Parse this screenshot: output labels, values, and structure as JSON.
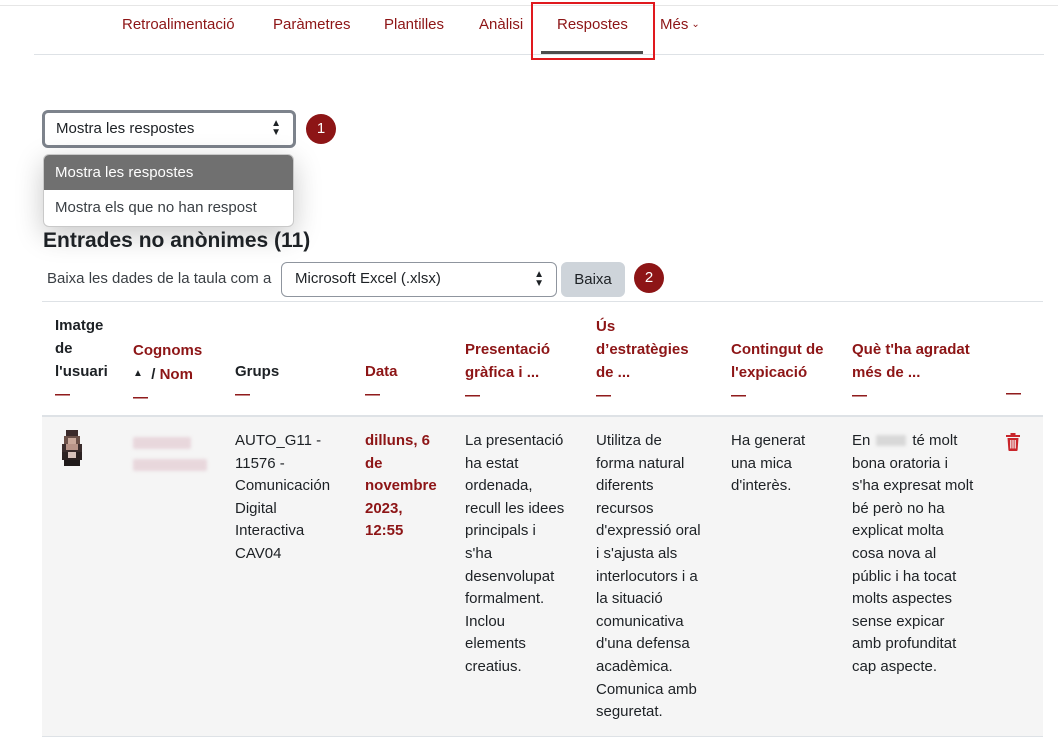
{
  "nav": {
    "tabs": [
      {
        "label": "Retroalimentació"
      },
      {
        "label": "Paràmetres"
      },
      {
        "label": "Plantilles"
      },
      {
        "label": "Anàlisi"
      },
      {
        "label": "Respostes"
      },
      {
        "label": "Més"
      }
    ]
  },
  "response_filter": {
    "selected": "Mostra les respostes",
    "options": [
      "Mostra les respostes",
      "Mostra els que no han respost"
    ]
  },
  "badges": {
    "first": "1",
    "second": "2"
  },
  "section": {
    "title": "Entrades no anònimes (11)"
  },
  "download": {
    "label": "Baixa les dades de la taula com a",
    "format": "Microsoft Excel (.xlsx)",
    "button": "Baixa"
  },
  "table": {
    "headers": {
      "image_line1": "Imatge",
      "image_line2": "de",
      "image_line3": "l'usuari",
      "surname": "Cognoms",
      "name": "Nom",
      "groups": "Grups",
      "date": "Data",
      "q1_line1": "Presentació",
      "q1_line2": "gràfica i ...",
      "q2_line1": "Ús",
      "q2_line2": "d’estratègies",
      "q2_line3": "de ...",
      "q3_line1": "Contingut de",
      "q3_line2": "l'expicació",
      "q4_line1": "Què t'ha agradat",
      "q4_line2": "més de ...",
      "collapse": "—"
    },
    "rows": [
      {
        "group": [
          "AUTO_G11 -",
          "11576 -",
          "Comunicación",
          "Digital",
          "Interactiva",
          "CAV04"
        ],
        "date": [
          "dilluns, 6",
          "de",
          "novembre",
          "2023,",
          "12:55"
        ],
        "q1": [
          "La presentació",
          "ha estat",
          "ordenada,",
          "recull les idees",
          "principals i",
          "s'ha",
          "desenvolupat",
          "formalment.",
          "Inclou",
          "elements",
          "creatius."
        ],
        "q2": [
          "Utilitza de",
          "forma natural",
          "diferents",
          "recursos",
          "d'expressió oral",
          "i s'ajusta als",
          "interlocutors i a",
          "la situació",
          "comunicativa",
          "d'una defensa",
          "acadèmica.",
          "Comunica amb",
          "seguretat."
        ],
        "q3": [
          "Ha generat",
          "una mica",
          "d'interès."
        ],
        "q4_first_prefix": "En",
        "q4_first_suffix": "té molt",
        "q4": [
          "bona oratoria i",
          "s'ha expresat molt",
          "bé però no ha",
          "explicat molta",
          "cosa nova al",
          "públic i ha tocat",
          "molts aspectes",
          "sense expicar",
          "amb profunditat",
          "cap aspecte."
        ]
      }
    ]
  },
  "colors": {
    "accent": "#8d1516",
    "highlight": "#e0191e",
    "button_bg": "#ced4da",
    "row_bg": "#f5f5f5"
  }
}
